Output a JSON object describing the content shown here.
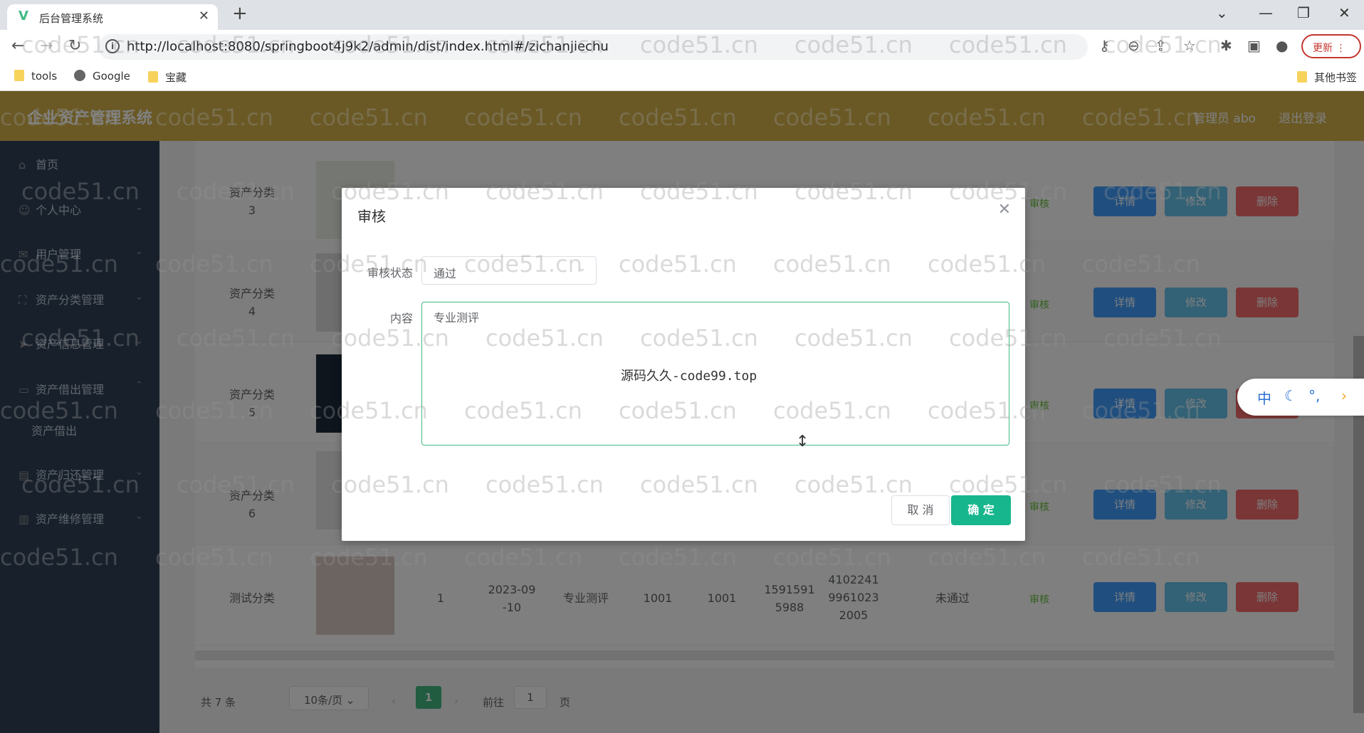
{
  "browser": {
    "tab_title": "后台管理系统",
    "url": "http://localhost:8080/springboot4j9k2/admin/dist/index.html#/zichanjiechu",
    "update_label": "更新",
    "bookmarks": [
      {
        "label": "tools",
        "icon": "folder-icon"
      },
      {
        "label": "Google",
        "icon": "globe-icon"
      },
      {
        "label": "宝藏",
        "icon": "folder-icon"
      }
    ],
    "other_bookmarks": "其他书签"
  },
  "app": {
    "brand": "企业资产管理系统",
    "user": "管理员 abo",
    "logout": "退出登录"
  },
  "sidebar": {
    "items": [
      {
        "label": "首页"
      },
      {
        "label": "个人中心"
      },
      {
        "label": "用户管理"
      },
      {
        "label": "资产分类管理"
      },
      {
        "label": "资产信息管理"
      },
      {
        "label": "资产借出管理"
      },
      {
        "label": "资产借出"
      },
      {
        "label": "资产归还管理"
      },
      {
        "label": "资产维修管理"
      }
    ]
  },
  "table": {
    "rows": [
      {
        "category": "资产分类\n3"
      },
      {
        "category": "资产分类\n4"
      },
      {
        "category": "资产分类\n5"
      },
      {
        "category": "资产分类\n6"
      },
      {
        "category": "测试分类",
        "qty": "1",
        "date": "2023-09\n-10",
        "content": "专业测评",
        "c1": "1001",
        "c2": "1001",
        "phone": "1591591\n5988",
        "idno": "4102241\n9961023\n2005",
        "status": "未通过"
      }
    ],
    "audit_label": "审核",
    "detail_label": "详情",
    "edit_label": "修改",
    "delete_label": "删除"
  },
  "pagination": {
    "total": "共 7 条",
    "page_size": "10条/页",
    "current": "1",
    "goto_prefix": "前往",
    "goto_value": "1",
    "goto_suffix": "页"
  },
  "dialog": {
    "title": "审核",
    "status_label": "审核状态",
    "status_value": "通过",
    "content_label": "内容",
    "content_value": "专业测评",
    "cancel": "取 消",
    "ok": "确 定"
  },
  "overlay_text": "源码久久-code99.top",
  "watermark": "code51.cn",
  "ime": {
    "lang": "中"
  }
}
